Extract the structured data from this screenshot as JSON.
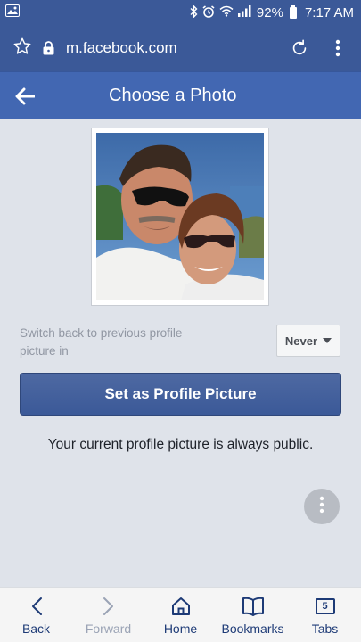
{
  "status_bar": {
    "battery": "92%",
    "time": "7:17 AM",
    "icons": [
      "image-icon",
      "bluetooth-icon",
      "alarm-icon",
      "wifi-icon",
      "signal-icon",
      "battery-icon"
    ]
  },
  "browser": {
    "url": "m.facebook.com",
    "icons": [
      "star-icon",
      "lock-icon",
      "reload-icon",
      "kebab-menu-icon"
    ]
  },
  "header": {
    "title": "Choose a Photo",
    "back_icon": "back-arrow-icon"
  },
  "main": {
    "switch_label": "Switch back to previous profile picture in",
    "switch_value": "Never",
    "set_button": "Set as Profile Picture",
    "public_note": "Your current profile picture is always public."
  },
  "bottom_nav": {
    "items": [
      {
        "label": "Back",
        "icon": "chevron-left-icon"
      },
      {
        "label": "Forward",
        "icon": "chevron-right-icon"
      },
      {
        "label": "Home",
        "icon": "home-icon"
      },
      {
        "label": "Bookmarks",
        "icon": "book-icon"
      },
      {
        "label": "Tabs",
        "icon": "tabs-icon",
        "count": "5"
      }
    ]
  },
  "colors": {
    "facebook_blue": "#3b5998",
    "header_blue": "#4267b2",
    "background": "#dfe3ea"
  }
}
